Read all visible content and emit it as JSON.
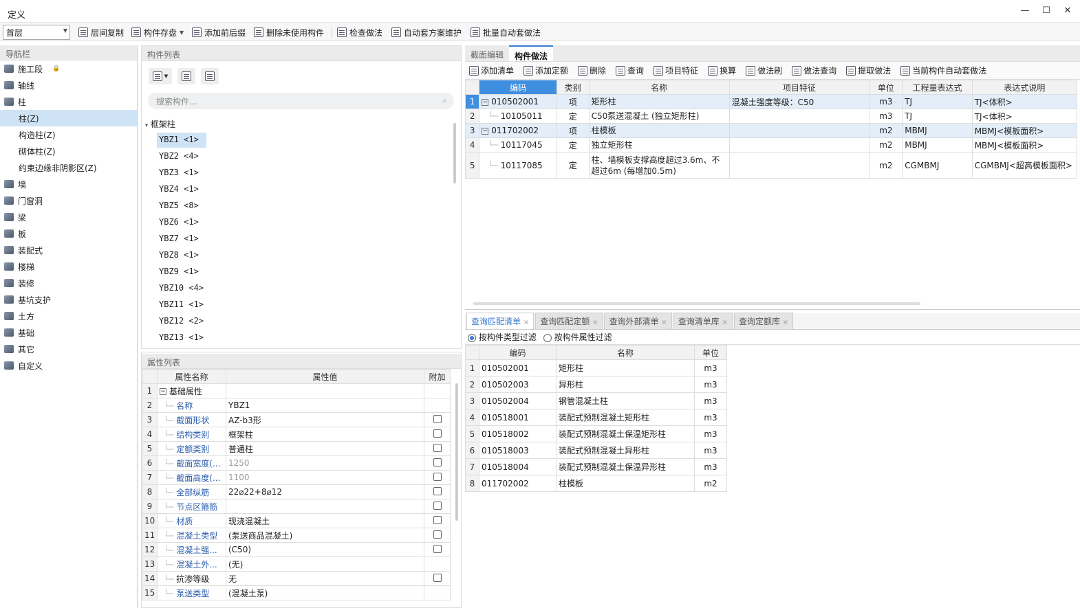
{
  "window": {
    "title": "定义",
    "min": "—",
    "max": "☐",
    "close": "✕"
  },
  "toolbar": {
    "floor": "首层",
    "buttons": [
      "层间复制",
      "构件存盘",
      "添加前后缀",
      "删除未使用构件",
      "检查做法",
      "自动套方案维护",
      "批量自动套做法"
    ]
  },
  "nav": {
    "title": "导航栏",
    "items": [
      {
        "label": "施工段",
        "sub": false
      },
      {
        "label": "轴线",
        "sub": false
      },
      {
        "label": "柱",
        "sub": false
      },
      {
        "label": "柱(Z)",
        "sub": true,
        "sel": true
      },
      {
        "label": "构造柱(Z)",
        "sub": true
      },
      {
        "label": "砌体柱(Z)",
        "sub": true
      },
      {
        "label": "约束边缘非阴影区(Z)",
        "sub": true
      },
      {
        "label": "墙",
        "sub": false
      },
      {
        "label": "门窗洞",
        "sub": false
      },
      {
        "label": "梁",
        "sub": false
      },
      {
        "label": "板",
        "sub": false
      },
      {
        "label": "装配式",
        "sub": false
      },
      {
        "label": "楼梯",
        "sub": false
      },
      {
        "label": "装修",
        "sub": false
      },
      {
        "label": "基坑支护",
        "sub": false
      },
      {
        "label": "土方",
        "sub": false
      },
      {
        "label": "基础",
        "sub": false
      },
      {
        "label": "其它",
        "sub": false
      },
      {
        "label": "自定义",
        "sub": false
      }
    ]
  },
  "component_list": {
    "title": "构件列表",
    "search_placeholder": "搜索构件...",
    "group": "框架柱",
    "items": [
      "YBZ1 <1>",
      "YBZ2 <4>",
      "YBZ3 <1>",
      "YBZ4 <1>",
      "YBZ5 <8>",
      "YBZ6 <1>",
      "YBZ7 <1>",
      "YBZ8 <1>",
      "YBZ9 <1>",
      "YBZ10 <4>",
      "YBZ11 <1>",
      "YBZ12 <2>",
      "YBZ13 <1>"
    ]
  },
  "props": {
    "title": "属性列表",
    "headers": [
      "属性名称",
      "属性值",
      "附加"
    ],
    "rows": [
      {
        "n": "1",
        "name": "基础属性",
        "val": "",
        "chk": false,
        "group": true
      },
      {
        "n": "2",
        "name": "名称",
        "val": "YBZ1",
        "chk": false
      },
      {
        "n": "3",
        "name": "截面形状",
        "val": "AZ-b3形",
        "chk": true
      },
      {
        "n": "4",
        "name": "结构类别",
        "val": "框架柱",
        "chk": true
      },
      {
        "n": "5",
        "name": "定额类别",
        "val": "普通柱",
        "chk": true
      },
      {
        "n": "6",
        "name": "截面宽度(...",
        "val": "1250",
        "chk": true,
        "grey": true
      },
      {
        "n": "7",
        "name": "截面高度(...",
        "val": "1100",
        "chk": true,
        "grey": true
      },
      {
        "n": "8",
        "name": "全部纵筋",
        "val": "22⌀22+8⌀12",
        "chk": true
      },
      {
        "n": "9",
        "name": "节点区箍筋",
        "val": "",
        "chk": true
      },
      {
        "n": "10",
        "name": "材质",
        "val": "现浇混凝土",
        "chk": true
      },
      {
        "n": "11",
        "name": "混凝土类型",
        "val": "(泵送商品混凝土)",
        "chk": true
      },
      {
        "n": "12",
        "name": "混凝土强...",
        "val": "(C50)",
        "chk": true
      },
      {
        "n": "13",
        "name": "混凝土外...",
        "val": "(无)",
        "chk": false
      },
      {
        "n": "14",
        "name": "抗渗等级",
        "val": "无",
        "chk": true,
        "black": true
      },
      {
        "n": "15",
        "name": "泵送类型",
        "val": "(混凝土泵)",
        "chk": false
      }
    ]
  },
  "right": {
    "tabs": [
      "截面编辑",
      "构件做法"
    ],
    "tools": [
      "添加清单",
      "添加定额",
      "删除",
      "查询",
      "项目特征",
      "换算",
      "做法刷",
      "做法查询",
      "提取做法",
      "当前构件自动套做法"
    ],
    "headers": [
      "编码",
      "类别",
      "名称",
      "项目特征",
      "单位",
      "工程量表达式",
      "表达式说明"
    ],
    "rows": [
      {
        "n": "1",
        "code": "010502001",
        "type": "项",
        "name": "矩形柱",
        "feat": "混凝土强度等级：C50",
        "unit": "m3",
        "expr": "TJ",
        "desc": "TJ<体积>",
        "item": true
      },
      {
        "n": "2",
        "code": "10105011",
        "type": "定",
        "name": "C50泵送混凝土 (独立矩形柱)",
        "feat": "",
        "unit": "m3",
        "expr": "TJ",
        "desc": "TJ<体积>"
      },
      {
        "n": "3",
        "code": "011702002",
        "type": "项",
        "name": "柱模板",
        "feat": "",
        "unit": "m2",
        "expr": "MBMJ",
        "desc": "MBMJ<模板面积>",
        "item": true
      },
      {
        "n": "4",
        "code": "10117045",
        "type": "定",
        "name": "独立矩形柱",
        "feat": "",
        "unit": "m2",
        "expr": "MBMJ",
        "desc": "MBMJ<模板面积>"
      },
      {
        "n": "5",
        "code": "10117085",
        "type": "定",
        "name": "柱、墙模板支撑高度超过3.6m、不超过6m (每增加0.5m)",
        "feat": "",
        "unit": "m2",
        "expr": "CGMBMJ",
        "desc": "CGMBMJ<超高模板面积>"
      }
    ],
    "bottom_tabs": [
      "查询匹配清单",
      "查询匹配定额",
      "查询外部清单",
      "查询清单库",
      "查询定额库"
    ],
    "filter1": "按构件类型过滤",
    "filter2": "按构件属性过滤",
    "bottom_headers": [
      "编码",
      "名称",
      "单位"
    ],
    "bottom_rows": [
      {
        "n": "1",
        "code": "010502001",
        "name": "矩形柱",
        "unit": "m3"
      },
      {
        "n": "2",
        "code": "010502003",
        "name": "异形柱",
        "unit": "m3"
      },
      {
        "n": "3",
        "code": "010502004",
        "name": "钢管混凝土柱",
        "unit": "m3"
      },
      {
        "n": "4",
        "code": "010518001",
        "name": "装配式预制混凝土矩形柱",
        "unit": "m3"
      },
      {
        "n": "5",
        "code": "010518002",
        "name": "装配式预制混凝土保温矩形柱",
        "unit": "m3"
      },
      {
        "n": "6",
        "code": "010518003",
        "name": "装配式预制混凝土异形柱",
        "unit": "m3"
      },
      {
        "n": "7",
        "code": "010518004",
        "name": "装配式预制混凝土保温异形柱",
        "unit": "m3"
      },
      {
        "n": "8",
        "code": "011702002",
        "name": "柱模板",
        "unit": "m2"
      }
    ]
  }
}
